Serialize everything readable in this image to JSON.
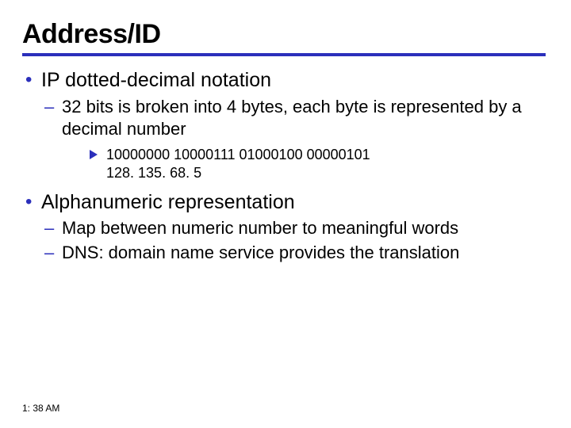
{
  "slide": {
    "title": "Address/ID",
    "bullets": [
      {
        "text": "IP dotted-decimal notation",
        "sub": [
          {
            "text": "32 bits is broken into 4 bytes, each byte is represented by a decimal number",
            "arrow": {
              "line1": "10000000 10000111 01000100 00000101",
              "line2": "128. 135. 68. 5"
            }
          }
        ]
      },
      {
        "text": "Alphanumeric representation",
        "sub": [
          {
            "text": "Map between numeric number to meaningful words"
          },
          {
            "text": "DNS: domain name service provides the translation"
          }
        ]
      }
    ]
  },
  "footer": {
    "timestamp": "1: 38 AM"
  }
}
